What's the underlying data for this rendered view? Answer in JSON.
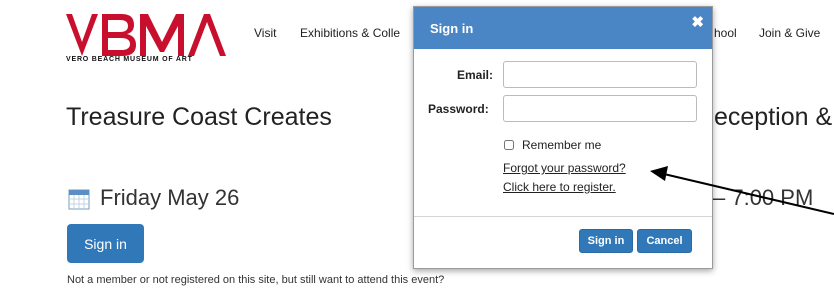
{
  "header": {
    "logo_text": "VBMA",
    "logo_tagline": "VERO BEACH MUSEUM OF ART",
    "nav": [
      "Visit",
      "Exhibitions & Colle",
      "hool",
      "Join & Give"
    ]
  },
  "event": {
    "title_left": "Treasure Coast Creates",
    "title_right": "eception &",
    "date": "Friday May 26",
    "time": "–  7:00 PM",
    "signin_label": "Sign in",
    "note": "Not a member or not registered on this site, but still want to attend this event?"
  },
  "modal": {
    "title": "Sign in",
    "close_glyph": "✖",
    "email_label": "Email:",
    "email_value": "",
    "password_label": "Password:",
    "password_value": "",
    "remember_label": "Remember me",
    "forgot_link": "Forgot your password?",
    "register_link": "Click here to register.",
    "signin_button": "Sign in",
    "cancel_button": "Cancel"
  },
  "colors": {
    "brand_red": "#c8102e",
    "header_blue": "#4a86c5",
    "button_blue": "#3178b9"
  },
  "icons": [
    "calendar-icon",
    "close-icon",
    "annotation-arrow"
  ]
}
